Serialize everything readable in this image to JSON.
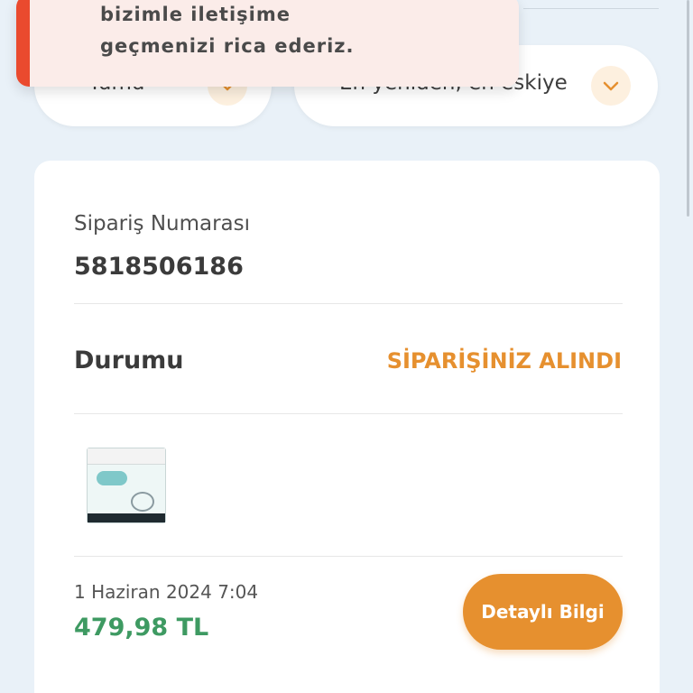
{
  "toast": {
    "line1": "bizimle iletişime",
    "line2": "geçmenizi rica ederiz."
  },
  "filters": {
    "type_value": "Tümü",
    "sort_value": "En yeniden, en eskiye"
  },
  "order": {
    "number_label": "Sipariş Numarası",
    "number": "5818506186",
    "status_label": "Durumu",
    "status_value": "SİPARİŞİNİZ ALINDI",
    "date": "1 Haziran 2024 7:04",
    "price": "479,98 TL",
    "detail_button": "Detaylı Bilgi",
    "product_icon": "product-thumbnail"
  },
  "colors": {
    "accent": "#e6902f",
    "price": "#3e9a62",
    "toast_accent": "#ea4a2e"
  }
}
